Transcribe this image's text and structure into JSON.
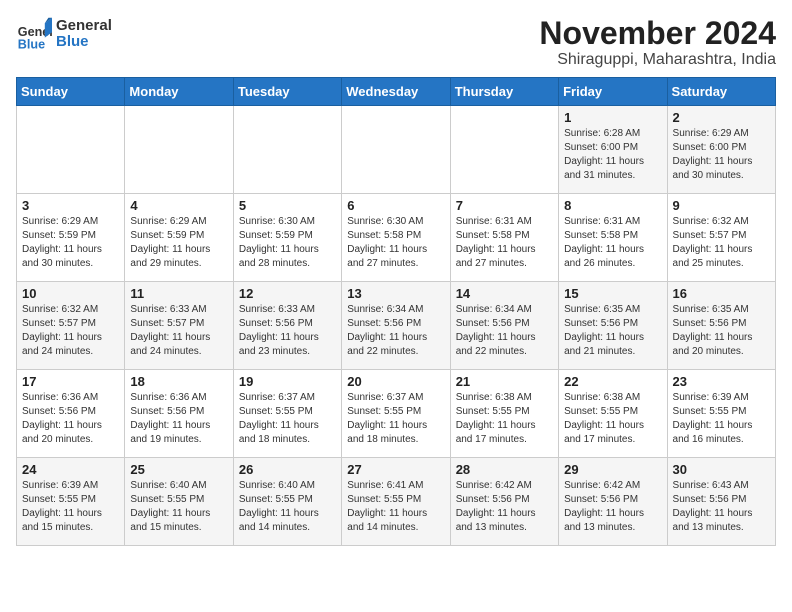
{
  "header": {
    "logo_line1": "General",
    "logo_line2": "Blue",
    "month": "November 2024",
    "location": "Shiraguppi, Maharashtra, India"
  },
  "weekdays": [
    "Sunday",
    "Monday",
    "Tuesday",
    "Wednesday",
    "Thursday",
    "Friday",
    "Saturday"
  ],
  "weeks": [
    [
      {
        "day": "",
        "content": ""
      },
      {
        "day": "",
        "content": ""
      },
      {
        "day": "",
        "content": ""
      },
      {
        "day": "",
        "content": ""
      },
      {
        "day": "",
        "content": ""
      },
      {
        "day": "1",
        "content": "Sunrise: 6:28 AM\nSunset: 6:00 PM\nDaylight: 11 hours and 31 minutes."
      },
      {
        "day": "2",
        "content": "Sunrise: 6:29 AM\nSunset: 6:00 PM\nDaylight: 11 hours and 30 minutes."
      }
    ],
    [
      {
        "day": "3",
        "content": "Sunrise: 6:29 AM\nSunset: 5:59 PM\nDaylight: 11 hours and 30 minutes."
      },
      {
        "day": "4",
        "content": "Sunrise: 6:29 AM\nSunset: 5:59 PM\nDaylight: 11 hours and 29 minutes."
      },
      {
        "day": "5",
        "content": "Sunrise: 6:30 AM\nSunset: 5:59 PM\nDaylight: 11 hours and 28 minutes."
      },
      {
        "day": "6",
        "content": "Sunrise: 6:30 AM\nSunset: 5:58 PM\nDaylight: 11 hours and 27 minutes."
      },
      {
        "day": "7",
        "content": "Sunrise: 6:31 AM\nSunset: 5:58 PM\nDaylight: 11 hours and 27 minutes."
      },
      {
        "day": "8",
        "content": "Sunrise: 6:31 AM\nSunset: 5:58 PM\nDaylight: 11 hours and 26 minutes."
      },
      {
        "day": "9",
        "content": "Sunrise: 6:32 AM\nSunset: 5:57 PM\nDaylight: 11 hours and 25 minutes."
      }
    ],
    [
      {
        "day": "10",
        "content": "Sunrise: 6:32 AM\nSunset: 5:57 PM\nDaylight: 11 hours and 24 minutes."
      },
      {
        "day": "11",
        "content": "Sunrise: 6:33 AM\nSunset: 5:57 PM\nDaylight: 11 hours and 24 minutes."
      },
      {
        "day": "12",
        "content": "Sunrise: 6:33 AM\nSunset: 5:56 PM\nDaylight: 11 hours and 23 minutes."
      },
      {
        "day": "13",
        "content": "Sunrise: 6:34 AM\nSunset: 5:56 PM\nDaylight: 11 hours and 22 minutes."
      },
      {
        "day": "14",
        "content": "Sunrise: 6:34 AM\nSunset: 5:56 PM\nDaylight: 11 hours and 22 minutes."
      },
      {
        "day": "15",
        "content": "Sunrise: 6:35 AM\nSunset: 5:56 PM\nDaylight: 11 hours and 21 minutes."
      },
      {
        "day": "16",
        "content": "Sunrise: 6:35 AM\nSunset: 5:56 PM\nDaylight: 11 hours and 20 minutes."
      }
    ],
    [
      {
        "day": "17",
        "content": "Sunrise: 6:36 AM\nSunset: 5:56 PM\nDaylight: 11 hours and 20 minutes."
      },
      {
        "day": "18",
        "content": "Sunrise: 6:36 AM\nSunset: 5:56 PM\nDaylight: 11 hours and 19 minutes."
      },
      {
        "day": "19",
        "content": "Sunrise: 6:37 AM\nSunset: 5:55 PM\nDaylight: 11 hours and 18 minutes."
      },
      {
        "day": "20",
        "content": "Sunrise: 6:37 AM\nSunset: 5:55 PM\nDaylight: 11 hours and 18 minutes."
      },
      {
        "day": "21",
        "content": "Sunrise: 6:38 AM\nSunset: 5:55 PM\nDaylight: 11 hours and 17 minutes."
      },
      {
        "day": "22",
        "content": "Sunrise: 6:38 AM\nSunset: 5:55 PM\nDaylight: 11 hours and 17 minutes."
      },
      {
        "day": "23",
        "content": "Sunrise: 6:39 AM\nSunset: 5:55 PM\nDaylight: 11 hours and 16 minutes."
      }
    ],
    [
      {
        "day": "24",
        "content": "Sunrise: 6:39 AM\nSunset: 5:55 PM\nDaylight: 11 hours and 15 minutes."
      },
      {
        "day": "25",
        "content": "Sunrise: 6:40 AM\nSunset: 5:55 PM\nDaylight: 11 hours and 15 minutes."
      },
      {
        "day": "26",
        "content": "Sunrise: 6:40 AM\nSunset: 5:55 PM\nDaylight: 11 hours and 14 minutes."
      },
      {
        "day": "27",
        "content": "Sunrise: 6:41 AM\nSunset: 5:55 PM\nDaylight: 11 hours and 14 minutes."
      },
      {
        "day": "28",
        "content": "Sunrise: 6:42 AM\nSunset: 5:56 PM\nDaylight: 11 hours and 13 minutes."
      },
      {
        "day": "29",
        "content": "Sunrise: 6:42 AM\nSunset: 5:56 PM\nDaylight: 11 hours and 13 minutes."
      },
      {
        "day": "30",
        "content": "Sunrise: 6:43 AM\nSunset: 5:56 PM\nDaylight: 11 hours and 13 minutes."
      }
    ]
  ]
}
